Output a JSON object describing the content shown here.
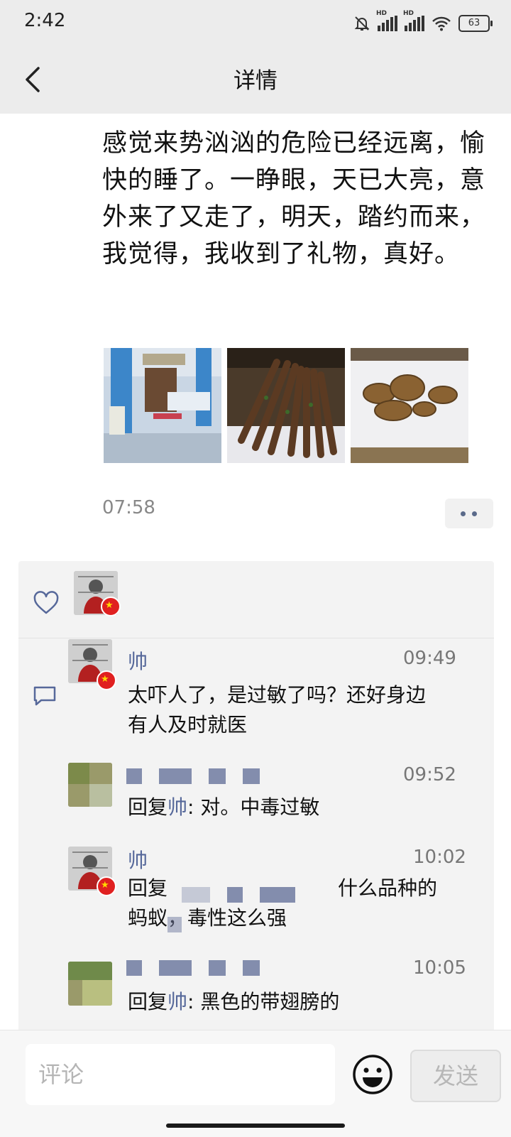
{
  "status": {
    "time": "2:42",
    "battery": "63",
    "hd": "HD"
  },
  "header": {
    "title": "详情"
  },
  "post": {
    "text": "感觉来势汹汹的危险已经远离，愉快的睡了。一睁眼，天已大亮，意外来了又走了，明天，踏约而来，我觉得，我收到了礼物，真好。",
    "time": "07:58",
    "photos": [
      "hospital-ward-photo",
      "skewers-photo",
      "fried-rolls-photo"
    ]
  },
  "comments": [
    {
      "name": "帅",
      "time": "09:49",
      "line1": "太吓人了，是过敏了吗？还好身边",
      "line2": "有人及时就医"
    },
    {
      "time": "09:52",
      "reply_prefix": "回复",
      "reply_to": "帅",
      "text": ": 对。中毒过敏"
    },
    {
      "name": "帅",
      "time": "10:02",
      "line1_prefix": "回复",
      "line1_suffix": "什么品种的",
      "line2": "蚂蚁，毒性这么强"
    },
    {
      "time": "10:05",
      "reply_prefix": "回复",
      "reply_to": "帅",
      "text": ": 黑色的带翅膀的"
    }
  ],
  "composer": {
    "placeholder": "评论",
    "send_label": "发送"
  },
  "colors": {
    "link": "#56689a",
    "panel": "#f3f3f3",
    "bar": "#ececec"
  }
}
